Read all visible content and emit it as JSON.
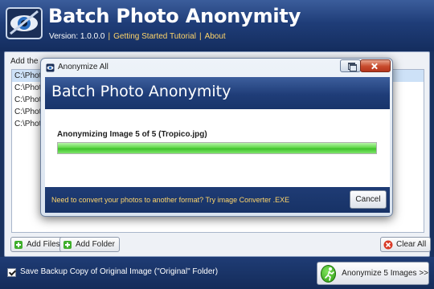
{
  "app": {
    "title": "Batch Photo Anonymity",
    "version": "Version: 1.0.0.0",
    "links": [
      "Getting Started Tutorial",
      "About"
    ]
  },
  "file_list": {
    "caption": "Add the",
    "rows": [
      "C:\\Phot",
      "C:\\Phot",
      "C:\\Phot",
      "C:\\Phot",
      "C:\\Phot"
    ],
    "selected_index": 0
  },
  "buttons": {
    "add_files": "Add Files",
    "add_folder": "Add Folder",
    "clear_all": "Clear All",
    "anonymize": "Anonymize 5 Images >>"
  },
  "backup_option": {
    "label": "Save Backup Copy of Original Image (\"Original\" Folder)",
    "checked": true
  },
  "dialog": {
    "window_title": "Anonymize All",
    "banner_title": "Batch Photo Anonymity",
    "progress_label": "Anonymizing Image 5 of 5 (Tropico.jpg)",
    "progress_fraction": 1.0,
    "footer_text": "Need to convert your photos to another format? Try image Converter .EXE",
    "cancel_label": "Cancel"
  },
  "colors": {
    "header_blue": "#1f3d78",
    "link_gold": "#ffd56a",
    "progress_green": "#3fc12b"
  }
}
